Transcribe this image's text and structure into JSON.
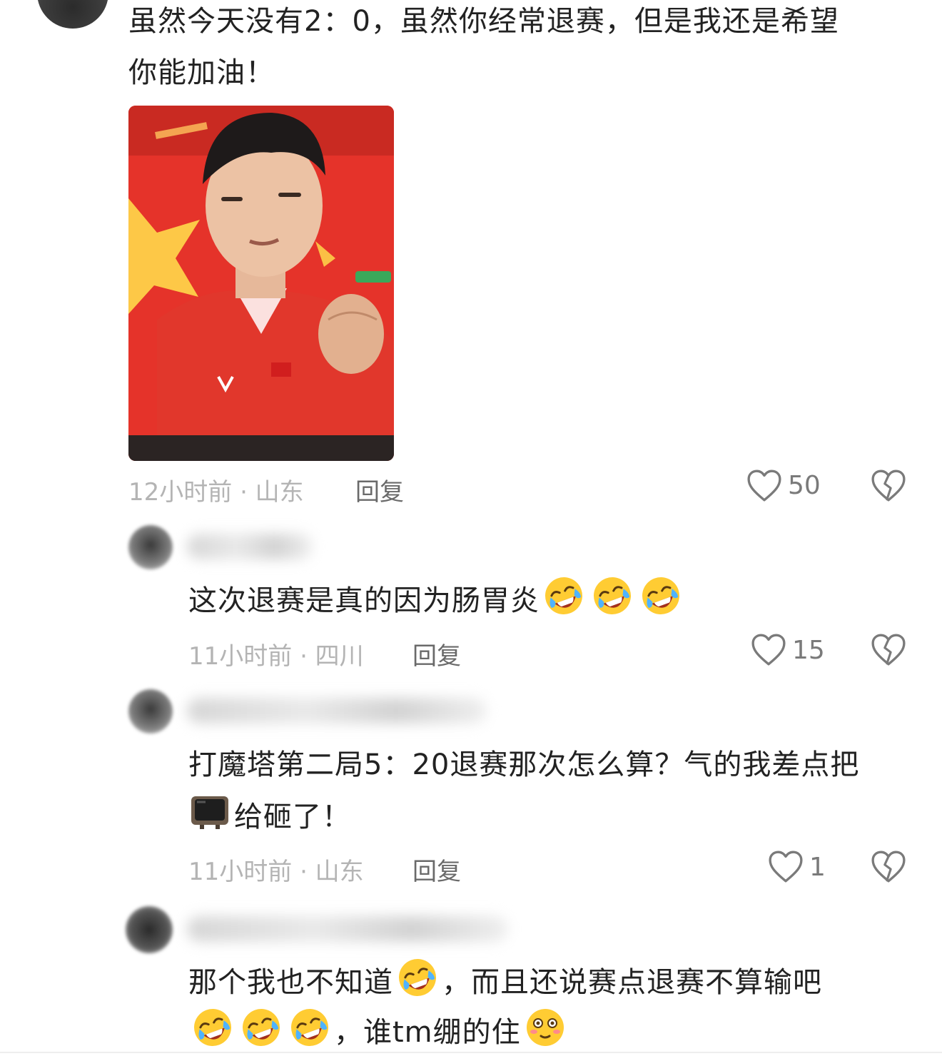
{
  "comment": {
    "line1": "虽然今天没有2：0，虽然你经常退赛，但是我还是希望",
    "line2": "你能加油！",
    "meta": "12小时前 · 山东",
    "reply_label": "回复",
    "likes": "50"
  },
  "replies": [
    {
      "lines": [
        "这次退赛是真的因为肠胃炎"
      ],
      "emoji_after": [
        "rofl",
        "rofl",
        "rofl"
      ],
      "meta": "11小时前 · 四川",
      "reply_label": "回复",
      "likes": "15"
    },
    {
      "line1": "打魔塔第二局5：20退赛那次怎么算？气的我差点把",
      "line2_after_icon": "给砸了！",
      "meta": "11小时前 · 山东",
      "reply_label": "回复",
      "likes": "1"
    },
    {
      "line1_part1": "那个我也不知道",
      "line1_part2": "，而且还说赛点退赛不算输吧",
      "line2_part": "，谁tm绷的住"
    }
  ],
  "icons": {
    "like": "heart-outline-icon",
    "dislike": "broken-heart-icon",
    "emoji_laugh": "rofl-emoji",
    "emoji_flushed": "flushed-face-emoji",
    "tv": "television-emoji"
  },
  "colors": {
    "flag_red": "#e5332a",
    "meta_gray": "#b4b4b4",
    "text": "#222222"
  }
}
